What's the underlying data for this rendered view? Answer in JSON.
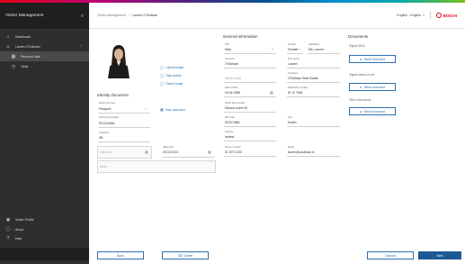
{
  "colors": {
    "accent": "#2b6fb0",
    "primary_button": "#1d5a94",
    "sidebar_bg": "#2e2e2e",
    "brand_red": "#e20015"
  },
  "app": {
    "title": "Visitor Management"
  },
  "sidebar": {
    "items": [
      {
        "label": "Dashboard",
        "icon": "home-icon"
      },
      {
        "label": "Lauren O'Sullivan",
        "icon": "user-icon"
      },
      {
        "label": "Personal data",
        "icon": "id-card-icon"
      },
      {
        "label": "Visits",
        "icon": "clock-icon"
      }
    ],
    "bottom_items": [
      {
        "label": "Visitor Profile",
        "icon": "profile-icon"
      },
      {
        "label": "About",
        "icon": "info-icon"
      },
      {
        "label": "Help",
        "icon": "help-icon"
      }
    ]
  },
  "header": {
    "breadcrumb_parent": "Visitor Management",
    "breadcrumb_sep": "/",
    "breadcrumb_current": "Lauren O'Sullivan",
    "language": "English - English",
    "brand": "BOSCH"
  },
  "photo_actions": {
    "upload": "Upload image",
    "camera": "Take picture",
    "delete": "Delete image"
  },
  "general": {
    "title": "General information",
    "title_label": "Title",
    "title_value": "Miss",
    "gender_label": "Gender",
    "gender_value": "Female",
    "salutation_label": "Salutation",
    "salutation_value": "Ms. Lauren",
    "surname_label": "Surname",
    "surname_value": "O'Sullivan",
    "firstname_label": "First name",
    "firstname_value": "Lauren",
    "middlename_placeholder": "Middle name",
    "company_label": "Company",
    "company_value": "O'Sullivan Real Estate",
    "dob_label": "Date of birth",
    "dob_value": "04.04.1988",
    "nationality_label": "Nationality number",
    "nationality_value": "IE 12 7548",
    "street_label": "Street and number",
    "street_value": "Marcus street 30",
    "zip_label": "ZIP code",
    "zip_value": "D02XY866",
    "city_label": "City",
    "city_value": "Dublin",
    "country_label": "Country",
    "country_value": "Ireland",
    "phone_label": "Phone number",
    "phone_value": "01 879 1230",
    "email_label": "Email",
    "email_value": "lauren@osullivan.ie"
  },
  "identity": {
    "title": "Identity document",
    "doctype_label": "Document type",
    "doctype_value": "Passport",
    "scan_label": "Scan document",
    "docnum_label": "Document number",
    "docnum_value": "P01234560",
    "issuer_label": "Issued by",
    "issuer_value": "IRL",
    "valid_from_placeholder": "Valid from",
    "valid_until_label": "Valid until",
    "valid_until_value": "09.02.2024",
    "notes_placeholder": "Notes"
  },
  "documents": {
    "title": "Documents",
    "signed_nda_label": "Signed NDA",
    "signed_terms_label": "Signed terms of use",
    "other_label": "Other documents",
    "select_label": "Select document"
  },
  "footer": {
    "back_label": "Back",
    "delete_label": "Delete",
    "discard_label": "Discard",
    "next_label": "Next"
  }
}
